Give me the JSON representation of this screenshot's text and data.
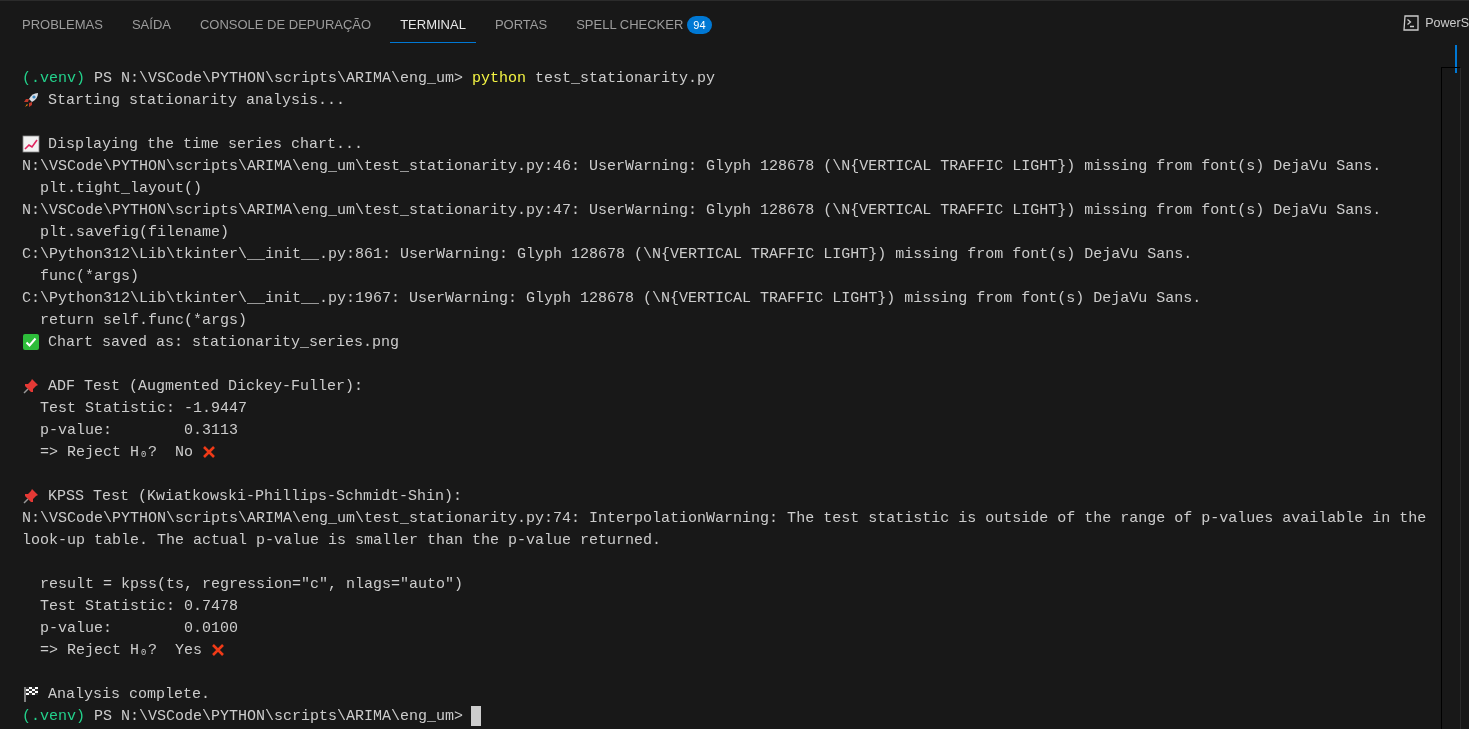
{
  "tabs": [
    {
      "label": "PROBLEMAS",
      "selected": false
    },
    {
      "label": "SAÍDA",
      "selected": false
    },
    {
      "label": "CONSOLE DE DEPURAÇÃO",
      "selected": false
    },
    {
      "label": "TERMINAL",
      "selected": true
    },
    {
      "label": "PORTAS",
      "selected": false
    },
    {
      "label": "SPELL CHECKER",
      "selected": false,
      "badge": "94"
    }
  ],
  "terminal_name": "PowerS",
  "lines": [
    {
      "kind": "blank"
    },
    {
      "kind": "prompt",
      "env": "(.venv)",
      "path": "PS N:\\VSCode\\PYTHON\\scripts\\ARIMA\\eng_um>",
      "command": "python",
      "args": "test_stationarity.py"
    },
    {
      "kind": "rocket",
      "text": "Starting stationarity analysis..."
    },
    {
      "kind": "blank"
    },
    {
      "kind": "chart",
      "text": "Displaying the time series chart..."
    },
    {
      "kind": "text",
      "text": "N:\\VSCode\\PYTHON\\scripts\\ARIMA\\eng_um\\test_stationarity.py:46: UserWarning: Glyph 128678 (\\N{VERTICAL TRAFFIC LIGHT}) missing from font(s) DejaVu Sans."
    },
    {
      "kind": "text",
      "text": "  plt.tight_layout()"
    },
    {
      "kind": "text",
      "text": "N:\\VSCode\\PYTHON\\scripts\\ARIMA\\eng_um\\test_stationarity.py:47: UserWarning: Glyph 128678 (\\N{VERTICAL TRAFFIC LIGHT}) missing from font(s) DejaVu Sans."
    },
    {
      "kind": "text",
      "text": "  plt.savefig(filename)"
    },
    {
      "kind": "text",
      "text": "C:\\Python312\\Lib\\tkinter\\__init__.py:861: UserWarning: Glyph 128678 (\\N{VERTICAL TRAFFIC LIGHT}) missing from font(s) DejaVu Sans."
    },
    {
      "kind": "text",
      "text": "  func(*args)"
    },
    {
      "kind": "text",
      "text": "C:\\Python312\\Lib\\tkinter\\__init__.py:1967: UserWarning: Glyph 128678 (\\N{VERTICAL TRAFFIC LIGHT}) missing from font(s) DejaVu Sans."
    },
    {
      "kind": "text",
      "text": "  return self.func(*args)"
    },
    {
      "kind": "check",
      "text": "Chart saved as: stationarity_series.png"
    },
    {
      "kind": "blank"
    },
    {
      "kind": "pin",
      "text": "ADF Test (Augmented Dickey-Fuller):"
    },
    {
      "kind": "text",
      "text": "  Test Statistic: -1.9447"
    },
    {
      "kind": "text",
      "text": "  p-value:        0.3113"
    },
    {
      "kind": "rejected",
      "text": "  => Reject H₀?  No"
    },
    {
      "kind": "blank"
    },
    {
      "kind": "pin",
      "text": "KPSS Test (Kwiatkowski-Phillips-Schmidt-Shin):"
    },
    {
      "kind": "text",
      "text": "N:\\VSCode\\PYTHON\\scripts\\ARIMA\\eng_um\\test_stationarity.py:74: InterpolationWarning: The test statistic is outside of the range of p-values available in the"
    },
    {
      "kind": "text",
      "text": "look-up table. The actual p-value is smaller than the p-value returned."
    },
    {
      "kind": "blank"
    },
    {
      "kind": "text",
      "text": "  result = kpss(ts, regression=\"c\", nlags=\"auto\")"
    },
    {
      "kind": "text",
      "text": "  Test Statistic: 0.7478"
    },
    {
      "kind": "text",
      "text": "  p-value:        0.0100"
    },
    {
      "kind": "rejected",
      "text": "  => Reject H₀?  Yes"
    },
    {
      "kind": "blank"
    },
    {
      "kind": "flag",
      "text": "Analysis complete."
    },
    {
      "kind": "prompt",
      "env": "(.venv)",
      "path": "PS N:\\VSCode\\PYTHON\\scripts\\ARIMA\\eng_um>",
      "cursor": true
    }
  ]
}
